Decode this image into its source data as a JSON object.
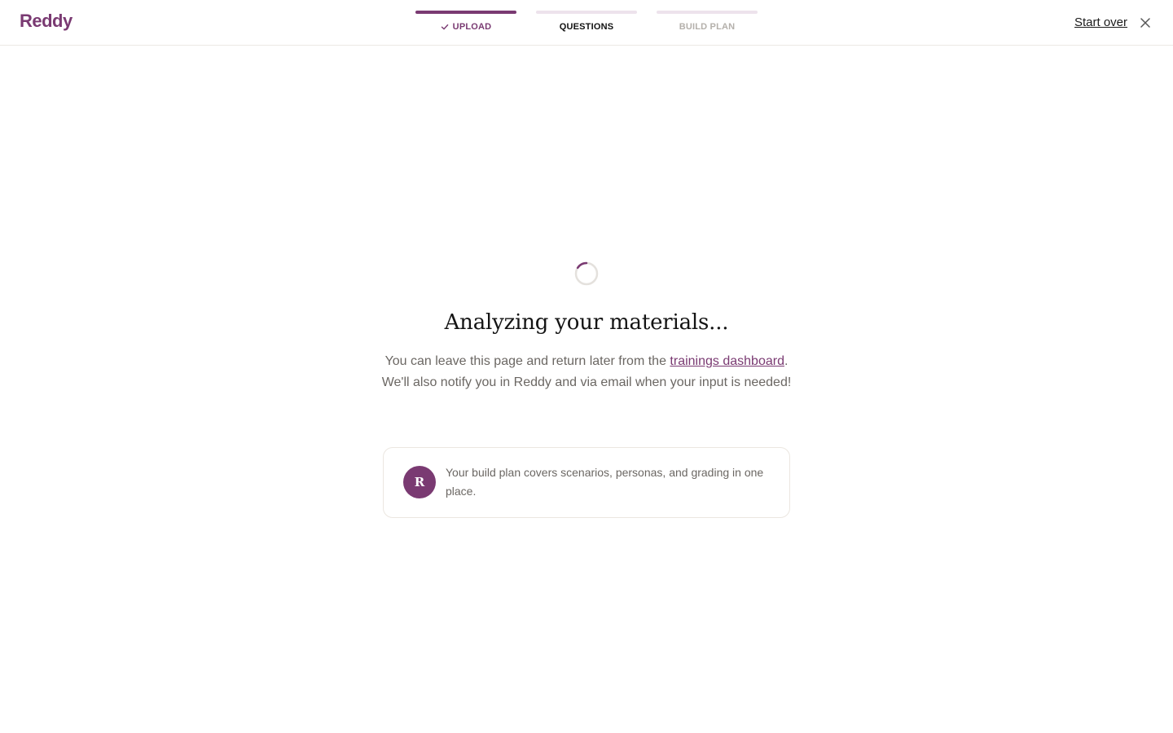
{
  "brand": {
    "name": "Reddy",
    "color": "#7a3a72"
  },
  "steps": [
    {
      "label": "UPLOAD",
      "state": "done",
      "icon": "check-icon"
    },
    {
      "label": "QUESTIONS",
      "state": "current"
    },
    {
      "label": "BUILD PLAN",
      "state": "pending"
    }
  ],
  "header": {
    "start_over_label": "Start over",
    "close_icon": "close-icon"
  },
  "main": {
    "spinner_icon": "loading-spinner-icon",
    "headline": "Analyzing your materials...",
    "body_before_link": "You can leave this page and return later from the ",
    "body_link": "trainings dashboard",
    "body_after_link": ". We'll also notify you in Reddy and via email when your input is needed!"
  },
  "tip": {
    "avatar_letter": "R",
    "text": "Your build plan covers scenarios, personas, and grading in one place."
  }
}
